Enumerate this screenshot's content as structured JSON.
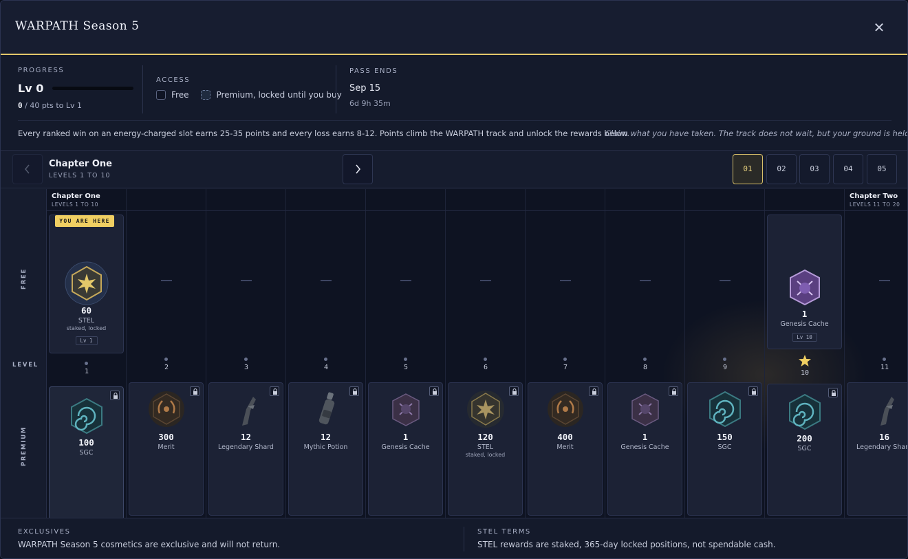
{
  "window": {
    "title": "WARPATH Season 5",
    "close_label": "✕"
  },
  "progress": {
    "caption": "PROGRESS",
    "level": "Lv 0",
    "points_current": "0",
    "points_rest": " / 40 pts to Lv 1",
    "bar_fraction": 0
  },
  "access": {
    "caption": "ACCESS",
    "free_label": "Free",
    "premium_label": "Premium, locked until you buy"
  },
  "pass_ends": {
    "caption": "PASS ENDS",
    "date": "Sep 15",
    "remaining": "6d 9h 35m"
  },
  "description": {
    "main": "Every ranked win on an energy-charged slot earns 25-35 points and every loss earns 8-12. Points climb the WARPATH track and unlock the rewards below.",
    "quote": "Claim what you have taken. The track does not wait, but your ground is held."
  },
  "chapter_nav": {
    "prev_icon": "chevron-left-icon",
    "next_icon": "chevron-right-icon",
    "title": "Chapter One",
    "subtitle": "LEVELS 1 TO 10",
    "pages": [
      "01",
      "02",
      "03",
      "04",
      "05"
    ],
    "active_page": "01"
  },
  "track": {
    "rail": {
      "free": "FREE",
      "level": "LEVEL",
      "premium": "PREMIUM"
    },
    "you_are_here": "YOU ARE HERE",
    "chapter_one": {
      "title": "Chapter One",
      "subtitle": "LEVELS 1 TO 10"
    },
    "chapter_two": {
      "title": "Chapter Two",
      "subtitle": "LEVELS 11 TO 20"
    },
    "levels": [
      {
        "num": "1",
        "free": {
          "icon": "stel-hex-icon",
          "amount": "60",
          "name": "STEL",
          "note": "staked, locked",
          "chip": "Lv 1"
        },
        "premium": {
          "icon": "sgc-swirl-icon",
          "amount": "100",
          "name": "SGC",
          "locked": false
        }
      },
      {
        "num": "2",
        "free": null,
        "premium": {
          "icon": "merit-laurel-icon",
          "amount": "300",
          "name": "Merit",
          "locked": true
        }
      },
      {
        "num": "3",
        "free": null,
        "premium": {
          "icon": "legendary-shard-icon",
          "amount": "12",
          "name": "Legendary Shard",
          "locked": true
        }
      },
      {
        "num": "4",
        "free": null,
        "premium": {
          "icon": "mythic-potion-icon",
          "amount": "12",
          "name": "Mythic Potion",
          "locked": true
        }
      },
      {
        "num": "5",
        "free": null,
        "premium": {
          "icon": "genesis-cache-icon",
          "amount": "1",
          "name": "Genesis Cache",
          "locked": true
        }
      },
      {
        "num": "6",
        "free": null,
        "premium": {
          "icon": "stel-hex-icon",
          "amount": "120",
          "name": "STEL",
          "note": "staked, locked",
          "locked": true
        }
      },
      {
        "num": "7",
        "free": null,
        "premium": {
          "icon": "merit-laurel-icon",
          "amount": "400",
          "name": "Merit",
          "locked": true
        }
      },
      {
        "num": "8",
        "free": null,
        "premium": {
          "icon": "genesis-cache-icon",
          "amount": "1",
          "name": "Genesis Cache",
          "locked": true
        }
      },
      {
        "num": "9",
        "free": null,
        "premium": {
          "icon": "sgc-swirl-icon",
          "amount": "150",
          "name": "SGC",
          "locked": true
        }
      },
      {
        "num": "10",
        "milestone": true,
        "free": {
          "icon": "genesis-cache-icon",
          "amount": "1",
          "name": "Genesis Cache",
          "chip": "Lv 10"
        },
        "premium": {
          "icon": "sgc-swirl-icon",
          "amount": "200",
          "name": "SGC",
          "locked": true
        }
      },
      {
        "num": "11",
        "free": null,
        "premium": {
          "icon": "legendary-shard-icon",
          "amount": "16",
          "name": "Legendary Shard",
          "locked": true
        }
      }
    ],
    "empty_marker": "—"
  },
  "footer": {
    "exclusives_caption": "EXCLUSIVES",
    "exclusives_text": "WARPATH Season 5 cosmetics are exclusive and will not return.",
    "stel_caption": "STEL TERMS",
    "stel_text": "STEL rewards are staked, 365-day locked positions, not spendable cash."
  },
  "colors": {
    "accent_gold": "#e4c86a",
    "badge_yellow": "#f0cf62",
    "panel": "#1c2235",
    "background": "#141a2b"
  }
}
